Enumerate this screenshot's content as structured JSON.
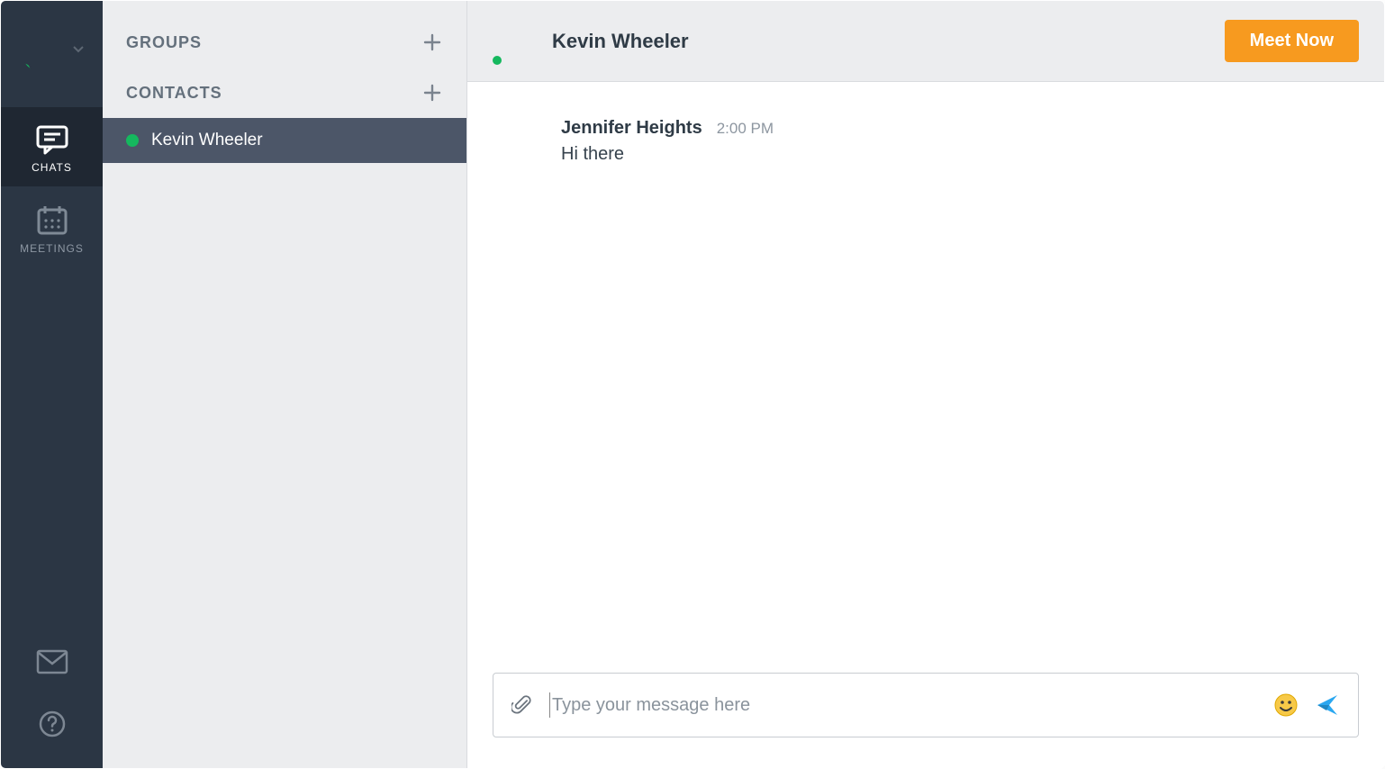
{
  "rail": {
    "nav": {
      "chats_label": "CHATS",
      "meetings_label": "MEETINGS"
    }
  },
  "panel": {
    "groups_header": "GROUPS",
    "contacts_header": "CONTACTS",
    "contacts": [
      {
        "name": "Kevin Wheeler",
        "presence": "online"
      }
    ]
  },
  "chat": {
    "header": {
      "title": "Kevin Wheeler",
      "meet_button": "Meet Now"
    },
    "messages": [
      {
        "sender": "Jennifer Heights",
        "time": "2:00 PM",
        "text": "Hi there"
      }
    ],
    "composer": {
      "placeholder": "Type your message here"
    }
  },
  "colors": {
    "accent": "#f79a1f",
    "presence_online": "#15b85e",
    "rail_bg": "#2b3644",
    "panel_bg": "#ecedef"
  }
}
